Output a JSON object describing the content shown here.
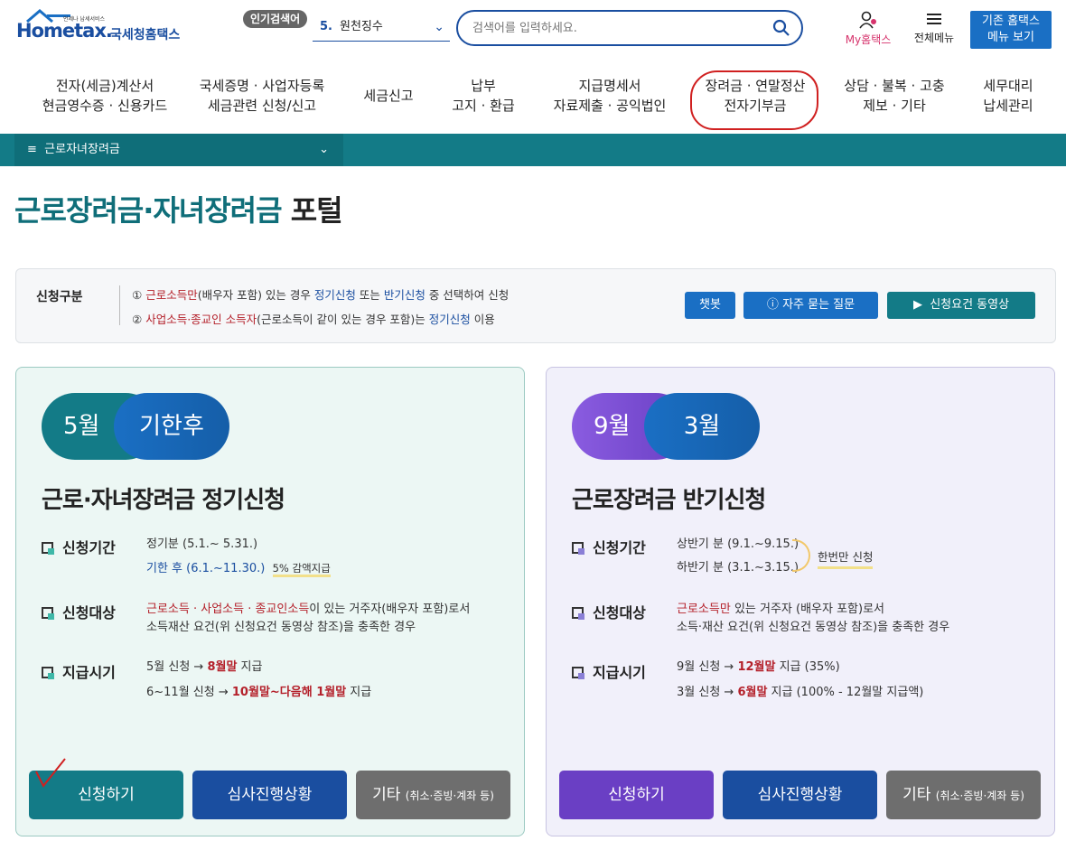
{
  "header": {
    "logo_tiny": "언제나 납세서비스",
    "logo_brand": "Hometax.",
    "logo_kr": "국세청홈택스",
    "popular_tag": "인기검색어",
    "popular_num": "5.",
    "popular_text": "원천징수",
    "search_placeholder": "검색어를 입력하세요.",
    "my_home": "My홈택스",
    "all_menu": "전체메뉴",
    "old_menu_line1": "기존 홈택스",
    "old_menu_line2": "메뉴 보기"
  },
  "gnb": [
    {
      "line1": "전자(세금)계산서",
      "line2": "현금영수증 · 신용카드"
    },
    {
      "line1": "국세증명 · 사업자등록",
      "line2": "세금관련 신청/신고"
    },
    {
      "line1": "세금신고",
      "line2": ""
    },
    {
      "line1": "납부",
      "line2": "고지 · 환급"
    },
    {
      "line1": "지급명세서",
      "line2": "자료제출 · 공익법인"
    },
    {
      "line1": "장려금 · 연말정산",
      "line2": "전자기부금"
    },
    {
      "line1": "상담 · 불복 · 고충",
      "line2": "제보 · 기타"
    },
    {
      "line1": "세무대리",
      "line2": "납세관리"
    }
  ],
  "lnb": {
    "label": "근로자녀장려금"
  },
  "page_title": {
    "teal": "근로장려금·자녀장려금",
    "dark": " 포털"
  },
  "info": {
    "label": "신청구분",
    "line1": {
      "num": "①",
      "red": "근로소득만",
      "a": "(배우자 포함) 있는 경우 ",
      "blue1": "정기신청",
      "b": " 또는 ",
      "blue2": "반기신청",
      "c": " 중 선택하여 신청"
    },
    "line2": {
      "num": "②",
      "red": "사업소득·종교인 소득자",
      "a": "(근로소득이 같이 있는 경우 포함)는 ",
      "blue1": "정기신청",
      "b": " 이용"
    },
    "btn_chatbot": "챗봇",
    "btn_faq": "자주 묻는 질문",
    "btn_video": "신청요건 동영상"
  },
  "left_card": {
    "pill_a": "5월",
    "pill_b": "기한후",
    "title": "근로·자녀장려금 정기신청",
    "period_label": "신청기간",
    "period_1": "정기분 (5.1.~ 5.31.)",
    "period_2": "기한 후 (6.1.~11.30.)",
    "period_2_note": "5% 감액지급",
    "target_label": "신청대상",
    "target_red": "근로소득 · 사업소득 · 종교인소득",
    "target_a": "이 있는 거주자(배우자 포함)로서",
    "target_b": "소득재산 요건(위 신청요건 동영상 참조)을 충족한 경우",
    "pay_label": "지급시기",
    "pay_1a": "5월 신청 → ",
    "pay_1red": "8월말",
    "pay_1b": " 지급",
    "pay_2a": "6~11월 신청 → ",
    "pay_2red": "10월말~다음해 1월말",
    "pay_2b": " 지급",
    "btn_apply": "신청하기",
    "btn_status": "심사진행상황",
    "btn_etc": "기타",
    "btn_etc_small": "(취소·증빙·계좌 등)"
  },
  "right_card": {
    "pill_a": "9월",
    "pill_b": "3월",
    "title": "근로장려금 반기신청",
    "period_label": "신청기간",
    "period_1": "상반기 분 (9.1.~9.15.)",
    "period_2": "하반기 분 (3.1.~3.15.)",
    "period_note": "한번만 신청",
    "target_label": "신청대상",
    "target_red": "근로소득만",
    "target_a": " 있는 거주자 (배우자 포함)로서",
    "target_b": "소득·재산 요건(위 신청요건 동영상 참조)을 충족한 경우",
    "pay_label": "지급시기",
    "pay_1a": "9월 신청 → ",
    "pay_1red": "12월말",
    "pay_1b": " 지급 (35%)",
    "pay_2a": "3월 신청 → ",
    "pay_2red": "6월말",
    "pay_2b": " 지급 (100% - 12월말 지급액)",
    "btn_apply": "신청하기",
    "btn_status": "심사진행상황",
    "btn_etc": "기타",
    "btn_etc_small": "(취소·증빙·계좌 등)"
  },
  "colors": {
    "teal": "#137b87",
    "blue": "#1a6fc4",
    "purple": "#6a3fc4",
    "red": "#b4202a",
    "gray_btn": "#6e6e6e"
  }
}
